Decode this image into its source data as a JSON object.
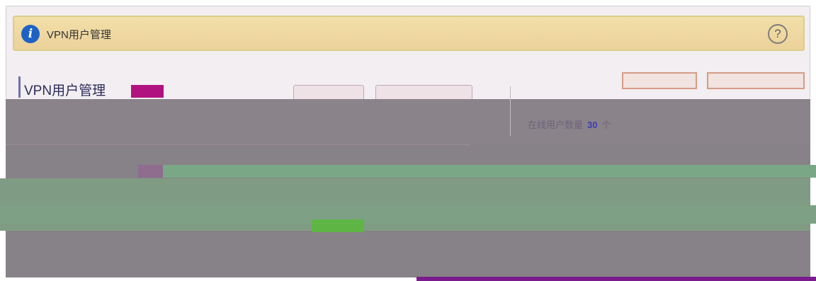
{
  "info_bar": {
    "title": "VPN用户管理",
    "info_icon": "info-icon",
    "help_icon": "question-circle-icon",
    "help_glyph": "?"
  },
  "section": {
    "title": "VPN用户管理"
  },
  "online": {
    "label_prefix": "在线用户数量",
    "count": "30",
    "label_suffix": "个"
  },
  "colors": {
    "info_bar_bg": "#f2dfa8",
    "info_icon": "#1e63c4",
    "green_row": "#809b83",
    "highlight": "#b0127f"
  }
}
